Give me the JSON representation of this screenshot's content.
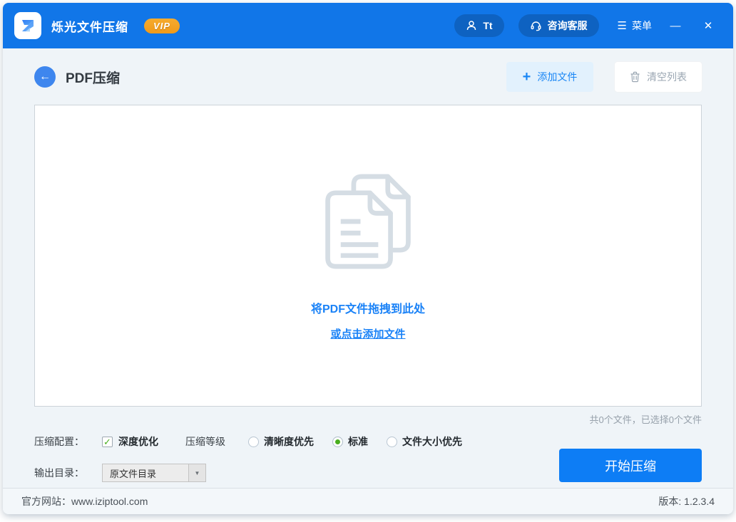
{
  "header": {
    "app_title": "烁光文件压缩",
    "vip_badge": "VIP",
    "user_label": "Tt",
    "support_label": "咨询客服",
    "menu_label": "菜单"
  },
  "toolbar": {
    "page_title": "PDF压缩",
    "add_files_label": "添加文件",
    "clear_list_label": "清空列表"
  },
  "dropzone": {
    "line1": "将PDF文件拖拽到此处",
    "line2": "或点击添加文件",
    "status": "共0个文件，已选择0个文件"
  },
  "settings": {
    "config_label": "压缩配置：",
    "deep_optimize_label": "深度优化",
    "deep_optimize_checked": true,
    "level_label": "压缩等级",
    "levels": [
      {
        "label": "清晰度优先",
        "selected": false
      },
      {
        "label": "标准",
        "selected": true
      },
      {
        "label": "文件大小优先",
        "selected": false
      }
    ],
    "output_label": "输出目录：",
    "output_value": "原文件目录",
    "start_label": "开始压缩"
  },
  "footer": {
    "website": "官方网站：www.iziptool.com",
    "version": "版本: 1.2.3.4"
  },
  "glyphs": {
    "back": "←",
    "plus": "+",
    "menu": "☰",
    "minimize": "—",
    "close": "✕",
    "check": "✓",
    "dropdown": "▼"
  },
  "colors": {
    "header_blue": "#1176e8",
    "accent_blue": "#1a82f7",
    "start_button_blue": "#0d7df5",
    "vip_orange": "#f2a024",
    "option_green": "#49ae1f"
  }
}
